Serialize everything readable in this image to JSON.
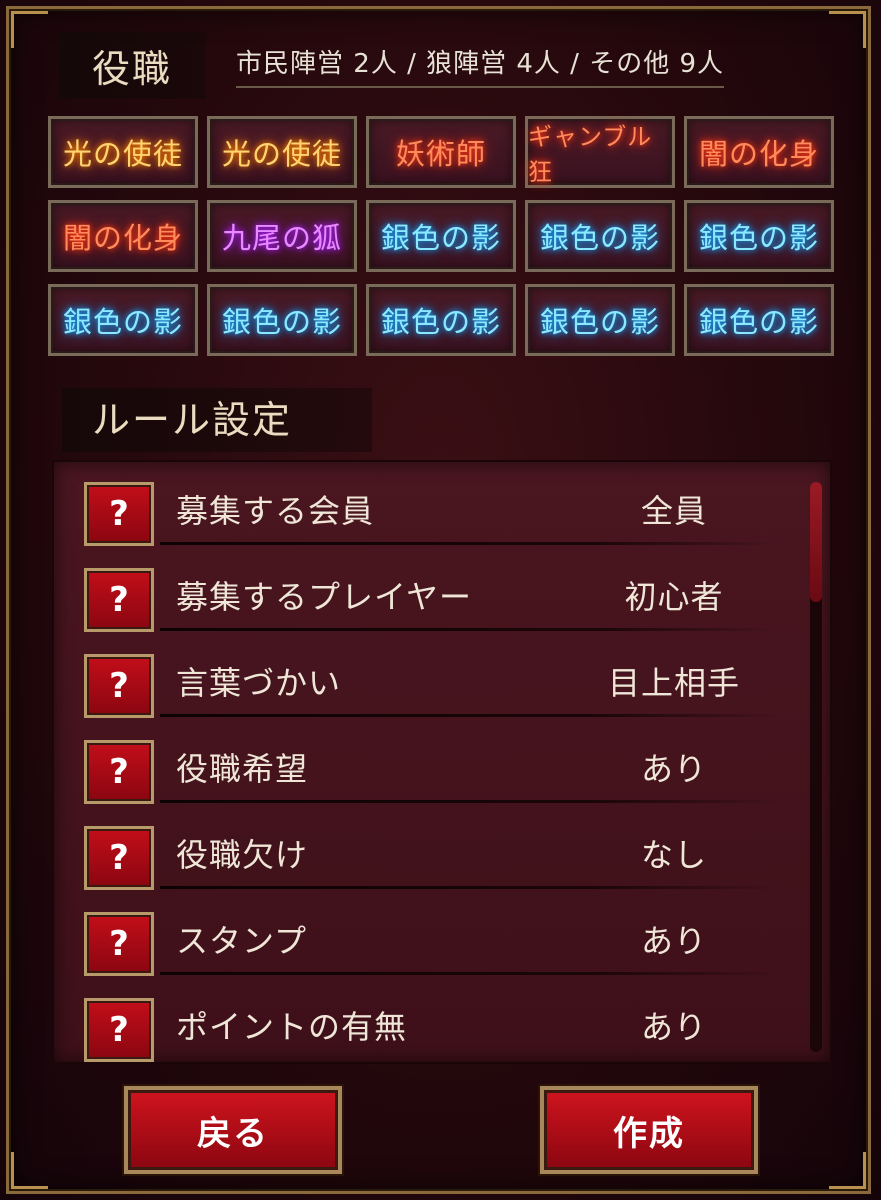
{
  "roles_header": {
    "title": "役職",
    "summary": "市民陣営 2人 / 狼陣営 4人 / その他 9人"
  },
  "roles": [
    {
      "name": "光の使徒",
      "color": "gold"
    },
    {
      "name": "光の使徒",
      "color": "gold"
    },
    {
      "name": "妖術師",
      "color": "red"
    },
    {
      "name": "ギャンブル狂",
      "color": "red"
    },
    {
      "name": "闇の化身",
      "color": "red"
    },
    {
      "name": "闇の化身",
      "color": "red"
    },
    {
      "name": "九尾の狐",
      "color": "purple"
    },
    {
      "name": "銀色の影",
      "color": "cyan"
    },
    {
      "name": "銀色の影",
      "color": "cyan"
    },
    {
      "name": "銀色の影",
      "color": "cyan"
    },
    {
      "name": "銀色の影",
      "color": "cyan"
    },
    {
      "name": "銀色の影",
      "color": "cyan"
    },
    {
      "name": "銀色の影",
      "color": "cyan"
    },
    {
      "name": "銀色の影",
      "color": "cyan"
    },
    {
      "name": "銀色の影",
      "color": "cyan"
    }
  ],
  "rules": {
    "title": "ルール設定",
    "help_icon": "?",
    "items": [
      {
        "label": "募集する会員",
        "value": "全員"
      },
      {
        "label": "募集するプレイヤー",
        "value": "初心者"
      },
      {
        "label": "言葉づかい",
        "value": "目上相手"
      },
      {
        "label": "役職希望",
        "value": "あり"
      },
      {
        "label": "役職欠け",
        "value": "なし"
      },
      {
        "label": "スタンプ",
        "value": "あり"
      },
      {
        "label": "ポイントの有無",
        "value": "あり"
      }
    ]
  },
  "buttons": {
    "back": "戻る",
    "create": "作成"
  },
  "colors": {
    "background": "#2a0a10",
    "gold_frame": "#b8914e",
    "button_red": "#c20e1a"
  }
}
